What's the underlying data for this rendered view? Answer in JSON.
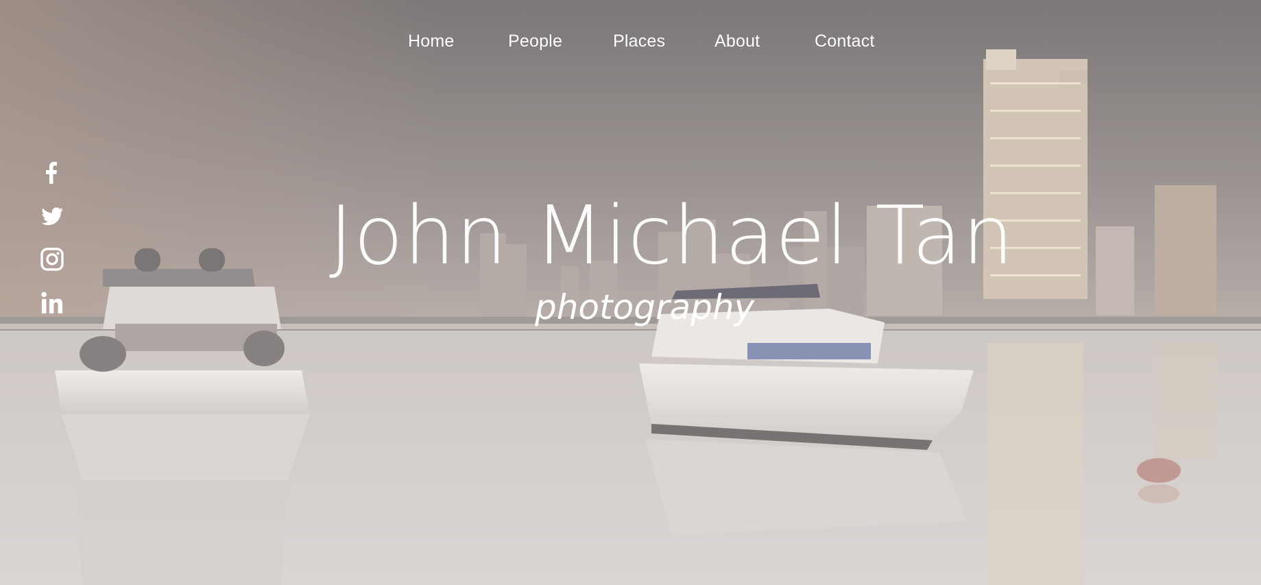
{
  "nav": {
    "items": [
      {
        "label": "Home"
      },
      {
        "label": "People"
      },
      {
        "label": "Places"
      },
      {
        "label": "About"
      },
      {
        "label": "Contact"
      }
    ]
  },
  "social": {
    "icons": [
      "facebook-icon",
      "twitter-icon",
      "instagram-icon",
      "linkedin-icon"
    ]
  },
  "hero": {
    "title": "John Michael Tan",
    "subtitle": "photography"
  },
  "colors": {
    "text": "#ffffff",
    "overlay": "#b9b3b2"
  }
}
